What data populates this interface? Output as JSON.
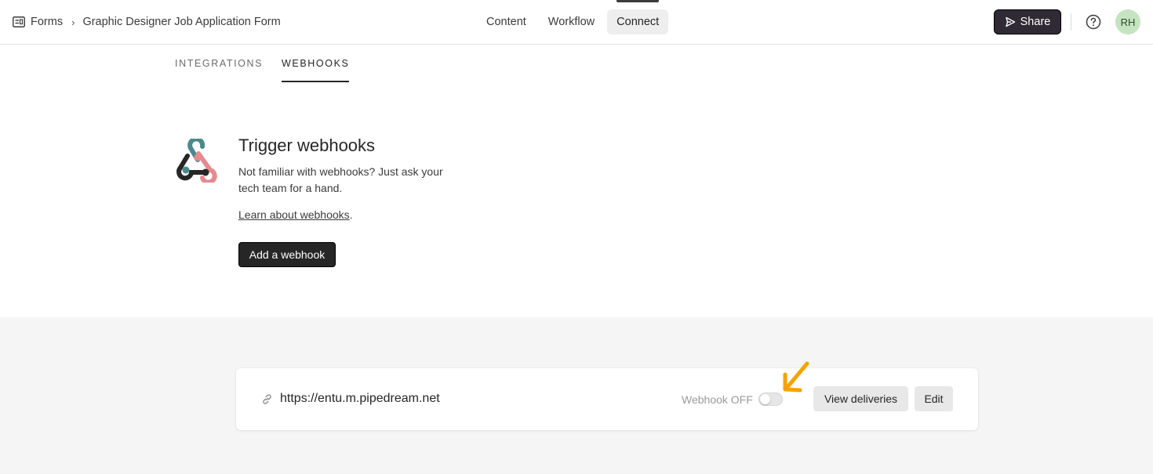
{
  "header": {
    "breadcrumb": {
      "root": "Forms",
      "separator": "›",
      "current": "Graphic Designer Job Application Form"
    },
    "nav_tabs": [
      {
        "label": "Content"
      },
      {
        "label": "Workflow"
      },
      {
        "label": "Connect",
        "active": true
      }
    ],
    "share_label": "Share",
    "avatar_initials": "RH",
    "icons": {
      "forms": "forms-icon",
      "share": "send-icon",
      "help": "help-circle-icon"
    }
  },
  "subtabs": [
    {
      "label": "INTEGRATIONS"
    },
    {
      "label": "WEBHOOKS",
      "active": true
    }
  ],
  "hero": {
    "icon": "webhook-icon",
    "title": "Trigger webhooks",
    "description": "Not familiar with webhooks? Just ask your tech team for a hand.",
    "learn_link": "Learn about webhooks",
    "learn_suffix": ".",
    "add_button": "Add a webhook"
  },
  "webhook": {
    "icon": "link-icon",
    "url": "https://entu.m.pipedream.net",
    "status_label": "Webhook OFF",
    "enabled": false,
    "view_deliveries": "View deliveries",
    "edit": "Edit",
    "annotation": "orange-arrow-icon"
  },
  "colors": {
    "primary_dark": "#262627",
    "share_bg": "#2f2a33",
    "avatar_bg": "#c6e3c1",
    "annotation": "#f5a300",
    "webhook_teal": "#4b8a8c",
    "webhook_pink": "#e58a8e"
  }
}
